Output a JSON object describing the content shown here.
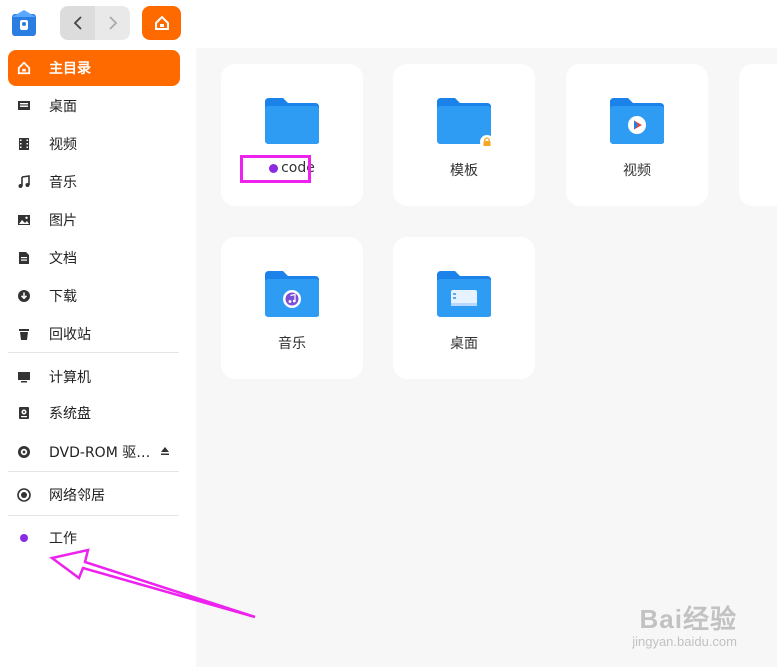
{
  "titlebar": {
    "back_icon": "chevron-left-icon",
    "forward_icon": "chevron-right-icon",
    "home_icon": "home-icon"
  },
  "sidebar": {
    "items": [
      {
        "label": "主目录",
        "icon": "home-icon"
      },
      {
        "label": "桌面",
        "icon": "desktop-icon"
      },
      {
        "label": "视频",
        "icon": "video-icon"
      },
      {
        "label": "音乐",
        "icon": "music-icon"
      },
      {
        "label": "图片",
        "icon": "picture-icon"
      },
      {
        "label": "文档",
        "icon": "document-icon"
      },
      {
        "label": "下载",
        "icon": "download-icon"
      },
      {
        "label": "回收站",
        "icon": "trash-icon"
      },
      {
        "label": "计算机",
        "icon": "computer-icon"
      },
      {
        "label": "系统盘",
        "icon": "disk-icon"
      },
      {
        "label": "DVD-ROM 驱…",
        "icon": "dvd-icon"
      },
      {
        "label": "网络邻居",
        "icon": "network-icon"
      },
      {
        "label": "工作",
        "icon": "tag-dot-icon"
      }
    ]
  },
  "files": [
    {
      "name": "code",
      "tagged": true
    },
    {
      "name": "模板",
      "locked": true
    },
    {
      "name": "视频"
    },
    {
      "name": "音乐"
    },
    {
      "name": "桌面"
    }
  ],
  "colors": {
    "accent": "#ff6a00",
    "tag": "#8a2be2",
    "annotation": "#ee22ee",
    "folder": "#1e90f0"
  },
  "watermark": {
    "logo": "Bai经验",
    "sub": "jingyan.baidu.com"
  }
}
